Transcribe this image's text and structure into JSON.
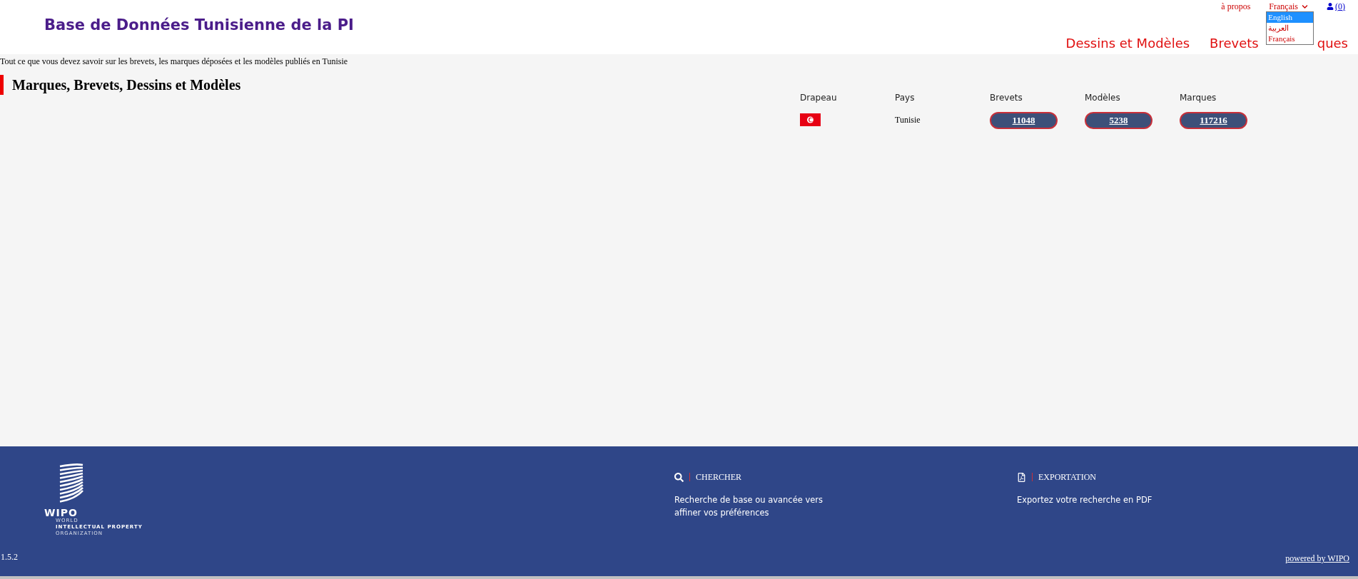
{
  "header": {
    "title": "Base de Données Tunisienne de la PI",
    "about_link": "à propos",
    "language": {
      "value": "Français",
      "options": [
        {
          "label": "English",
          "highlighted": true
        },
        {
          "label": "العربية",
          "highlighted": false
        },
        {
          "label": "Français",
          "highlighted": false
        }
      ]
    },
    "cart": "(0)",
    "nav": [
      "Dessins et Modèles",
      "Brevets",
      "ques"
    ]
  },
  "intro": "Tout ce que vous devez savoir sur les brevets, les marques déposées et les modèles publiés en Tunisie",
  "section_title": "Marques, Brevets, Dessins et Modèles",
  "table": {
    "columns": [
      "Drapeau",
      "Pays",
      "Brevets",
      "Modèles",
      "Marques"
    ],
    "rows": [
      {
        "country": "Tunisie",
        "counts": [
          "11048",
          "5238",
          "117216"
        ]
      }
    ]
  },
  "footer": {
    "logo": {
      "name": "WIPO",
      "lines": [
        "WORLD",
        "INTELLECTUAL PROPERTY",
        "ORGANIZATION"
      ]
    },
    "features": [
      {
        "kind": "search",
        "title": "CHERCHER",
        "text": "Recherche de base ou avancée vers affiner vos préférences"
      },
      {
        "kind": "pdf",
        "title": "EXPORTATION",
        "text": "Exportez votre recherche en PDF"
      }
    ],
    "version": "1.5.2",
    "powered": "powered by WIPO"
  }
}
